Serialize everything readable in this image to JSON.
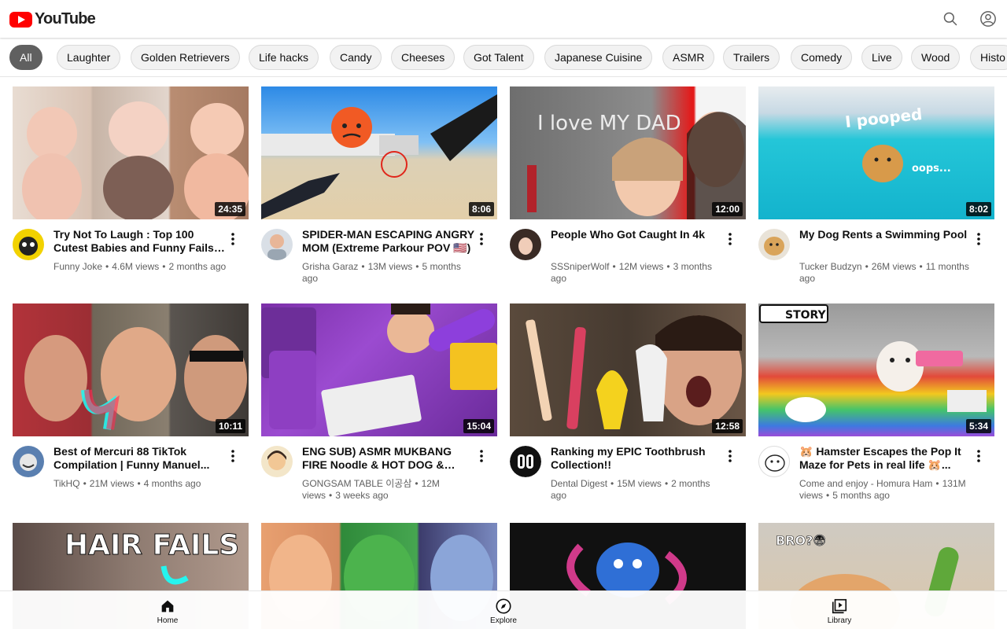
{
  "app": {
    "logo_text": "YouTube",
    "brand_color": "#ff0000"
  },
  "header": {
    "search_icon": "search-icon",
    "account_icon": "account-icon"
  },
  "chips": [
    {
      "label": "All",
      "active": true
    },
    {
      "label": "Laughter"
    },
    {
      "label": "Golden Retrievers"
    },
    {
      "label": "Life hacks"
    },
    {
      "label": "Candy"
    },
    {
      "label": "Cheeses"
    },
    {
      "label": "Got Talent"
    },
    {
      "label": "Japanese Cuisine"
    },
    {
      "label": "ASMR"
    },
    {
      "label": "Trailers"
    },
    {
      "label": "Comedy"
    },
    {
      "label": "Live"
    },
    {
      "label": "Wood"
    },
    {
      "label": "Histo"
    }
  ],
  "videos": [
    {
      "title": "Try Not To Laugh : Top 100 Cutest Babies and Funny Fails |...",
      "channel": "Funny Joke",
      "views": "4.6M views",
      "age": "2 months ago",
      "duration": "24:35"
    },
    {
      "title": "SPIDER-MAN ESCAPING ANGRY MOM (Extreme Parkour POV 🇺🇸)",
      "channel": "Grisha Garaz",
      "views": "13M views",
      "age": "5 months ago",
      "duration": "8:06"
    },
    {
      "title": "People Who Got Caught In 4k",
      "channel": "SSSniperWolf",
      "views": "12M views",
      "age": "3 months ago",
      "duration": "12:00"
    },
    {
      "title": "My Dog Rents a Swimming Pool",
      "channel": "Tucker Budzyn",
      "views": "26M views",
      "age": "11 months ago",
      "duration": "8:02"
    },
    {
      "title": "Best of Mercuri 88 TikTok Compilation | Funny Manuel...",
      "channel": "TikHQ",
      "views": "21M views",
      "age": "4 months ago",
      "duration": "10:11"
    },
    {
      "title": "ENG SUB) ASMR MUKBANG FIRE Noodle & HOT DOG & CHEESE...",
      "channel": "GONGSAM TABLE 이공삼",
      "views": "12M views",
      "age": "3 weeks ago",
      "duration": "15:04"
    },
    {
      "title": "Ranking my EPIC Toothbrush Collection!!",
      "channel": "Dental Digest",
      "views": "15M views",
      "age": "2 months ago",
      "duration": "12:58"
    },
    {
      "title": "🐹 Hamster Escapes the Pop It Maze for Pets in real life 🐹...",
      "channel": "Come and enjoy - Homura Ham",
      "views": "131M views",
      "age": "5 months ago",
      "duration": "5:34"
    },
    {
      "title": "",
      "channel": "",
      "views": "",
      "age": "",
      "duration": "",
      "thumb_text": "HAIR FAILS"
    },
    {
      "title": "",
      "channel": "",
      "views": "",
      "age": "",
      "duration": ""
    },
    {
      "title": "",
      "channel": "",
      "views": "",
      "age": "",
      "duration": ""
    },
    {
      "title": "",
      "channel": "",
      "views": "",
      "age": "",
      "duration": "",
      "thumb_text": "BRO?😨"
    }
  ],
  "thumb_texts": {
    "v2": "I love MY DAD",
    "v3": "I pooped",
    "v3b": "oops...",
    "v7": "STORY"
  },
  "bottom_nav": [
    {
      "label": "Home",
      "icon": "home-icon"
    },
    {
      "label": "Explore",
      "icon": "explore-icon"
    },
    {
      "label": "Library",
      "icon": "library-icon"
    }
  ]
}
